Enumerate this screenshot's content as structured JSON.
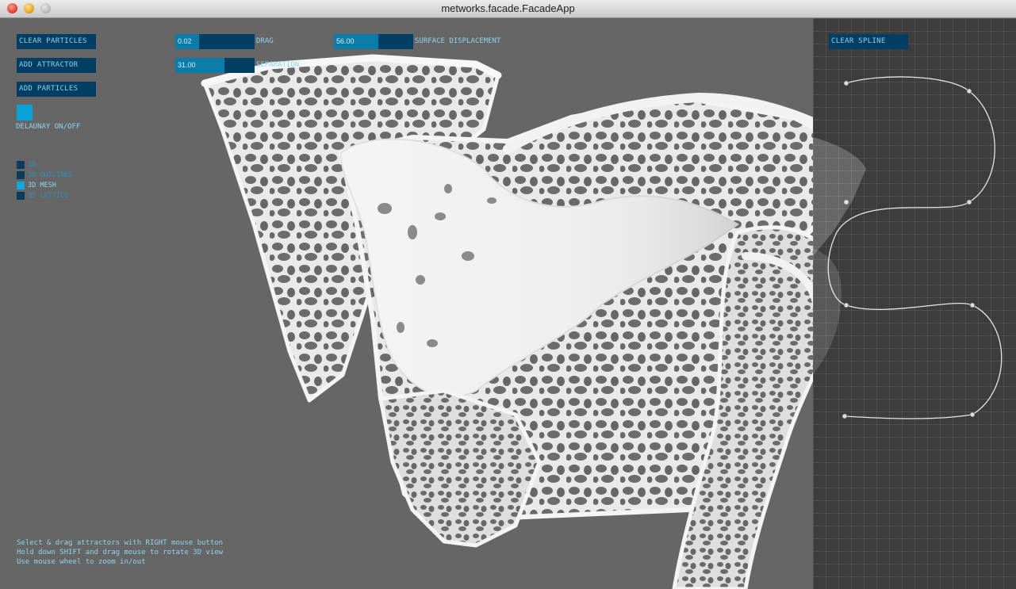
{
  "window": {
    "title": "metworks.facade.FacadeApp"
  },
  "controls": {
    "clear_particles": "CLEAR PARTICLES",
    "add_attractor": "ADD ATTRACTOR",
    "add_particles": "ADD PARTICLES",
    "delaunay_label": "DELAUNAY ON/OFF",
    "clear_spline": "CLEAR SPLINE"
  },
  "sliders": [
    {
      "label": "DRAG",
      "value": "0.02",
      "fraction": 0.3
    },
    {
      "label": "SEPARATION",
      "value": "31.00",
      "fraction": 0.62
    },
    {
      "label": "SURFACE DISPLACEMENT",
      "value": "56.00",
      "fraction": 0.56
    }
  ],
  "view_modes": [
    {
      "label": "2D",
      "selected": false
    },
    {
      "label": "3D OUTLINES",
      "selected": false
    },
    {
      "label": "3D MESH",
      "selected": true
    },
    {
      "label": "3D LATTICE",
      "selected": false
    }
  ],
  "help": [
    "Select & drag attractors with RIGHT mouse button",
    "Hold down SHIFT and drag mouse to rotate 3D view",
    "Use mouse wheel to zoom in/out"
  ],
  "colors": {
    "accent": "#0aa2d6",
    "button": "#003f63",
    "text": "#8fd3ee",
    "viewport": "#666666"
  }
}
